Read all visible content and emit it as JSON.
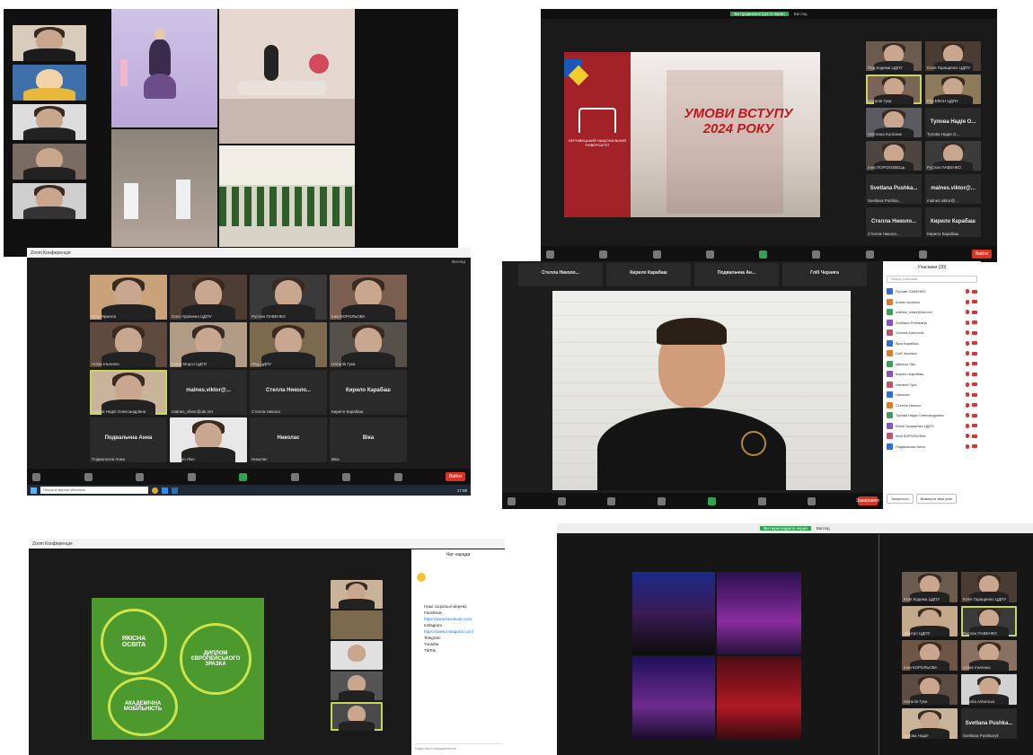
{
  "s2": {
    "tag1": "Ви продемонструєте екран",
    "tag2": "Вигляд",
    "title_line1": "УМОВИ ВСТУПУ",
    "title_line2": "2024 РОКУ",
    "logo_text": "ЧЕРНІВЕЦЬКИЙ НАЦІОНАЛЬНИЙ УНІВЕРСИТЕТ",
    "tiles": [
      {
        "name": "Пед.Кодема ЦДПУ",
        "bg": "#6b5a4e"
      },
      {
        "name": "Юлія Гаращенко ЦДПУ",
        "bg": "#4a3c33"
      },
      {
        "name": "Наталія Гука",
        "bg": "#7a6456",
        "sel": true
      },
      {
        "name": "Рул ЕВАН ЦДПУ",
        "bg": "#8d7a5a"
      },
      {
        "name": "Світлана Колісник",
        "bg": "#5a5a60"
      },
      {
        "name": "Тупова Надія О...",
        "big": true
      },
      {
        "name": "Інна ПОРОХОВЕЦЬ",
        "bg": "#4d4540"
      },
      {
        "name": "Руслан ПАВЕНКО",
        "bg": "#3b3b3b"
      },
      {
        "name": "Svetlana Pushka...",
        "big": true
      },
      {
        "name": "malnes.viktor@...",
        "big": true
      },
      {
        "name": "Стелла Николо...",
        "big": true
      },
      {
        "name": "Кирило Карабаш",
        "big": true
      }
    ],
    "end_label": "Вийти"
  },
  "s3": {
    "title": "Zoom Конференція",
    "view_label": "Вигляд",
    "tiles": [
      {
        "name": "Юля Ярмола",
        "bg": "#c9a27a"
      },
      {
        "name": "Олег Удовенко ЦДПУ",
        "bg": "#4d3d33"
      },
      {
        "name": "Руслан ПАВЕНКО",
        "bg": "#3a3a3a"
      },
      {
        "name": "Інна КОРОЛЬОВА",
        "bg": "#7a5e50"
      },
      {
        "name": "Аліна Ільченко",
        "bg": "#5e4a3e"
      },
      {
        "name": "Ірина Мороз ЦДПУ",
        "bg": "#b09b84"
      },
      {
        "name": "Пед.ЦДПУ",
        "bg": "#7b6a4e"
      },
      {
        "name": "Наталія Гука",
        "bg": "#56504a"
      },
      {
        "name": "Тупова Надія Олександрівна",
        "bg": "#c9b49a",
        "sel": true
      },
      {
        "name": "malnes_viktor@ukr.net",
        "big": true,
        "label": "malnes.viktor@..."
      },
      {
        "name": "Стелла Николо",
        "big": true,
        "label": "Стелла Николо..."
      },
      {
        "name": "Кирило Карабаш",
        "big": true,
        "label": "Кирило Карабаш"
      },
      {
        "name": "Подвальчна Анна",
        "big": true,
        "label": "Подвальчна Анна"
      },
      {
        "name": "Дмитро Ліко",
        "bg": "#e8e8e8"
      },
      {
        "name": "Николас",
        "big": true,
        "label": "Николас"
      },
      {
        "name": "Віка",
        "big": true,
        "label": "Віка"
      }
    ],
    "search_placeholder": "Пошук в мережі Windows",
    "clock": "17:08",
    "end_label": "Вийти"
  },
  "s4": {
    "top_names": [
      "Стелла Николо...",
      "Кирило Карабаш",
      "Подвальчна Ан...",
      "Гліб Черняга"
    ],
    "speaker": "Руслан ПАВЕНКО",
    "panel_title": "Учасники (20)",
    "panel_search": "Пошук учасника",
    "participants": [
      "Руслан ПАВЕНКО",
      "Аліна Ільченко",
      "malnes_viktor@ukr.net",
      "Svetlana Pushkaryk",
      "Victoria Antonova",
      "Віра Карабаш",
      "Гліб Черняга",
      "Дмитро Ліко",
      "Кирило Карабаш",
      "Наталія Гука",
      "Николас",
      "Стелла Николо",
      "Тупова Надія Олександрівна",
      "Юлія Гаращенко ЦДПУ",
      "Інна КОРОЛЬОВА",
      "Подвальчна Анна"
    ],
    "invite_btn": "Запросити",
    "mute_all_btn": "Вимкнути звук усім",
    "end_label": "Завершити"
  },
  "s5": {
    "title": "Zoom Конференція",
    "chat_title": "Чат наради",
    "circle1": "ЯКІСНА ОСВІТА",
    "circle2": "ДИПЛОМ ЄВРОПЕЙСЬКОГО ЗРАЗКА",
    "circle3": "АКАДЕМІЧНА МОБІЛЬНІСТЬ",
    "chat_lines": [
      "Наші соціальні мережі:",
      "Facebook",
      "https://www.facebook.com/",
      "Instagram",
      "https://www.instagram.com/",
      "Telegram",
      "Youtube",
      "TikTok"
    ],
    "chat_input": "Надіслати повідомлення"
  },
  "s6": {
    "tag1": "Ви переглядаєте екран",
    "tag2": "Вигляд",
    "tiles": [
      {
        "name": "Юля Кодема ЦДПУ",
        "bg": "#6b5a4e"
      },
      {
        "name": "Юлія Гаращенко ЦДПУ",
        "bg": "#4a3c33"
      },
      {
        "name": "Дмитро ЦДПУ",
        "bg": "#c4aa8a"
      },
      {
        "name": "Руслан ПАВЕНКО",
        "bg": "#3a3a3a",
        "sel": true
      },
      {
        "name": "Інна КОРОЛЬОВА",
        "bg": "#6e5546"
      },
      {
        "name": "Аліна Ільченко",
        "bg": "#8a7060"
      },
      {
        "name": "Наталія Гука",
        "bg": "#5c4c44"
      },
      {
        "name": "Victoria Antonova",
        "bg": "#d2d2d2"
      },
      {
        "name": "Тупова Надія",
        "bg": "#c9b49a"
      },
      {
        "name": "Svetlana Pushkaryk",
        "big": true,
        "label": "Svetlana Pushka..."
      }
    ]
  }
}
